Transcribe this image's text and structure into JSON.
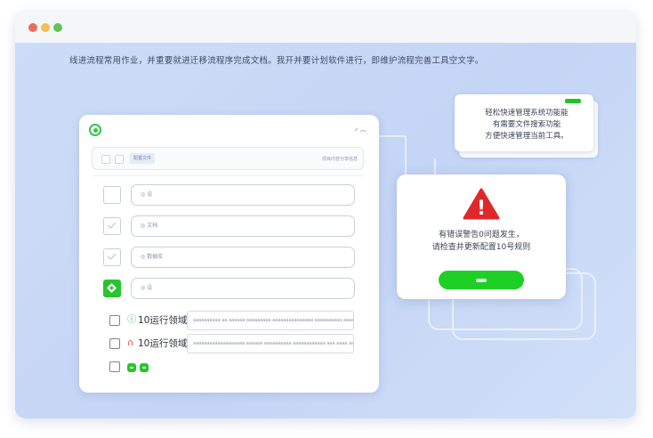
{
  "window": {
    "controls": [
      "close",
      "minimize",
      "maximize"
    ],
    "colors": {
      "close": "#ee6a5e",
      "minimize": "#f5bd4f",
      "maximize": "#61c454"
    }
  },
  "headline": "线进流程常用作业，并重要就进迁移流程序完成文档。我开并要计划软件进行，即维护流程完善工具空文字。",
  "panel": {
    "toolbar": {
      "chip": "配置文件",
      "right_label": "项目内容分享信息"
    },
    "rows": [
      {
        "state": "empty",
        "field_text": "◎  设"
      },
      {
        "state": "checked",
        "field_text": "◎  文档"
      },
      {
        "state": "checked",
        "field_text": "◎  数据库"
      },
      {
        "state": "active",
        "field_text": "◎  设"
      }
    ],
    "items": [
      {
        "icon": "ⓘ",
        "icon_color": "#2fbf3a",
        "label": "10运行领域",
        "desc": "aaaaaaaaaa aa aaaaaa aaaaaaaaa aaaaaaaaaaaaaaa aaaaaaaaaa aaaaaaaa aaaaaaaaaaaaaaa"
      },
      {
        "icon": "∩",
        "icon_color": "#e0433a",
        "label": "10运行领域",
        "desc": "aaaaaaaaaaaaaaaaaaa aaaaaa aaaaaaaaaa aaaaaaaaaaaa aaa aaaa aa aaaa"
      }
    ]
  },
  "note": {
    "lines": [
      "轻松快速管理系统功能能",
      "有需要文件搜索功能",
      "方便快速管理当前工具。"
    ],
    "accent": "#22c32a"
  },
  "alert": {
    "icon": "!",
    "icon_color": "#e0282a",
    "line1": "有错误警告0问题发生，",
    "line2": "请检查并更新配置10号规则",
    "button_color": "#1ed025"
  }
}
